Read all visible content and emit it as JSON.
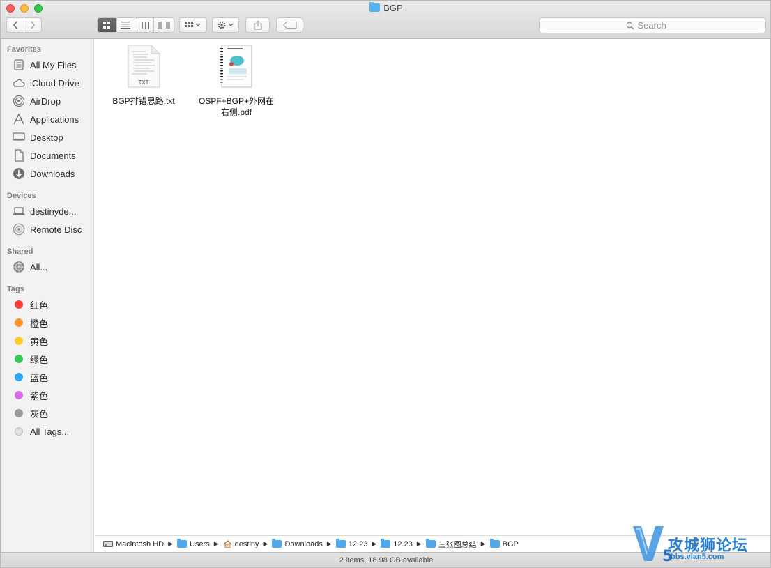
{
  "window": {
    "title": "BGP",
    "search_placeholder": "Search"
  },
  "sidebar": {
    "favorites_header": "Favorites",
    "favorites": [
      {
        "label": "All My Files",
        "icon": "all-files-icon"
      },
      {
        "label": "iCloud Drive",
        "icon": "cloud-icon"
      },
      {
        "label": "AirDrop",
        "icon": "airdrop-icon"
      },
      {
        "label": "Applications",
        "icon": "applications-icon"
      },
      {
        "label": "Desktop",
        "icon": "desktop-icon"
      },
      {
        "label": "Documents",
        "icon": "documents-icon"
      },
      {
        "label": "Downloads",
        "icon": "downloads-icon"
      }
    ],
    "devices_header": "Devices",
    "devices": [
      {
        "label": "destinyde...",
        "icon": "laptop-icon"
      },
      {
        "label": "Remote Disc",
        "icon": "disc-icon"
      }
    ],
    "shared_header": "Shared",
    "shared": [
      {
        "label": "All...",
        "icon": "network-icon"
      }
    ],
    "tags_header": "Tags",
    "tags": [
      {
        "label": "红色",
        "color": "#fc3d39"
      },
      {
        "label": "橙色",
        "color": "#fd9426"
      },
      {
        "label": "黄色",
        "color": "#fecb2e"
      },
      {
        "label": "绿色",
        "color": "#35c759"
      },
      {
        "label": "蓝色",
        "color": "#2ea7f3"
      },
      {
        "label": "紫色",
        "color": "#d66ee8"
      },
      {
        "label": "灰色",
        "color": "#9a9a9e"
      },
      {
        "label": "All Tags...",
        "color": "#dcdcdc"
      }
    ]
  },
  "files": [
    {
      "name": "BGP排错思路.txt",
      "kind": "TXT"
    },
    {
      "name": "OSPF+BGP+外网在右侧.pdf",
      "kind": "PDF"
    }
  ],
  "pathbar": [
    {
      "label": "Macintosh HD",
      "icon": "hard-drive-icon"
    },
    {
      "label": "Users",
      "icon": "folder-icon"
    },
    {
      "label": "destiny",
      "icon": "home-icon"
    },
    {
      "label": "Downloads",
      "icon": "folder-icon"
    },
    {
      "label": "12.23",
      "icon": "folder-icon"
    },
    {
      "label": "12.23",
      "icon": "folder-icon"
    },
    {
      "label": "三张图总结",
      "icon": "folder-icon"
    },
    {
      "label": "BGP",
      "icon": "folder-icon"
    }
  ],
  "status": "2 items, 18.98 GB available",
  "watermark": {
    "brand": "攻城狮论坛",
    "url": "bbs.vlan5.com",
    "logo": "V5"
  }
}
